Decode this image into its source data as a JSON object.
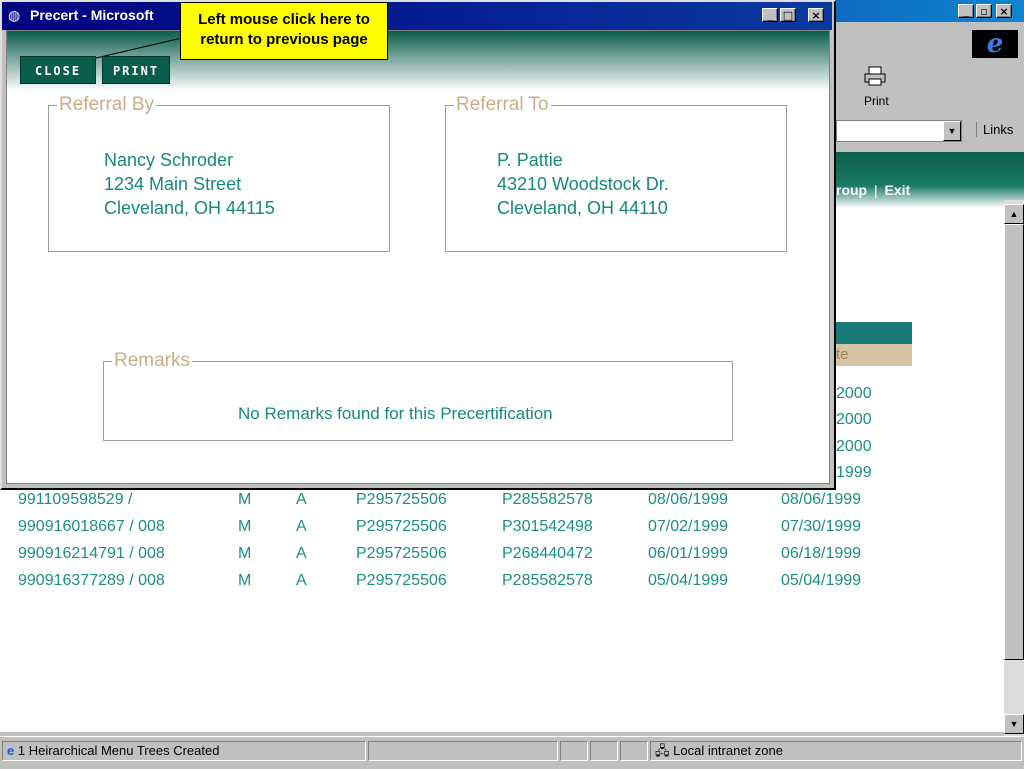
{
  "popup": {
    "title": "Precert - Microsoft",
    "buttons": {
      "close": "CLOSE",
      "print": "PRINT"
    },
    "referral_by": {
      "legend": "Referral By",
      "lines": [
        "Nancy Schroder",
        "1234 Main Street",
        "Cleveland, OH 44115"
      ]
    },
    "referral_to": {
      "legend": "Referral To",
      "lines": [
        "P. Pattie",
        "43210 Woodstock Dr.",
        "Cleveland, OH 44110"
      ]
    },
    "remarks": {
      "legend": "Remarks",
      "text": "No Remarks found for this Precertification"
    }
  },
  "callout": {
    "line1": "Left mouse click here to",
    "line2": "return to previous page"
  },
  "browser": {
    "print_label": "Print",
    "links_label": "Links",
    "nav": {
      "group": "roup",
      "separator": "|",
      "exit": "Exit"
    },
    "header_fragment": "te",
    "date_fragments": [
      "2000",
      "2000",
      "2000",
      "1999"
    ],
    "rows": [
      [
        "991109598529 /",
        "M",
        "A",
        "P295725506",
        "P285582578",
        "08/06/1999",
        "08/06/1999"
      ],
      [
        "990916018667 / 008",
        "M",
        "A",
        "P295725506",
        "P301542498",
        "07/02/1999",
        "07/30/1999"
      ],
      [
        "990916214791 / 008",
        "M",
        "A",
        "P295725506",
        "P268440472",
        "06/01/1999",
        "06/18/1999"
      ],
      [
        "990916377289 / 008",
        "M",
        "A",
        "P295725506",
        "P285582578",
        "05/04/1999",
        "05/04/1999"
      ]
    ]
  },
  "statusbar": {
    "message": "1 Heirarchical Menu Trees Created",
    "zone": "Local intranet zone"
  }
}
